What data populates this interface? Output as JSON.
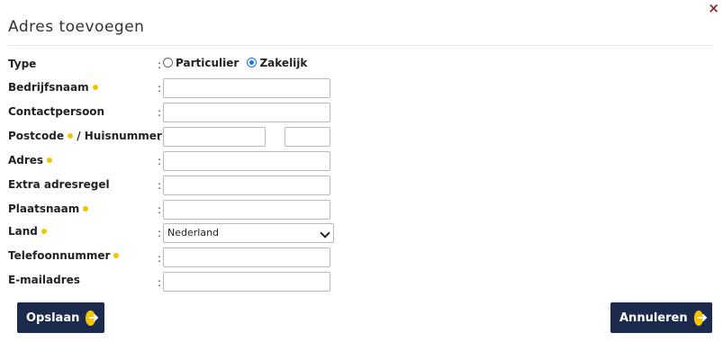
{
  "dialog": {
    "title": "Adres toevoegen",
    "close_icon": "×"
  },
  "form": {
    "colon": ":",
    "type": {
      "label": "Type",
      "options": [
        "Particulier",
        "Zakelijk"
      ],
      "selected": "Zakelijk"
    },
    "bedrijfsnaam": {
      "label": "Bedrijfsnaam",
      "required": true,
      "value": ""
    },
    "contactpersoon": {
      "label": "Contactpersoon",
      "required": false,
      "value": ""
    },
    "postcode": {
      "label": "Postcode",
      "separator": "/ Huisnummer",
      "required": true,
      "value": "",
      "huisnummer_value": ""
    },
    "adres": {
      "label": "Adres",
      "required": true,
      "value": ""
    },
    "extra_adresregel": {
      "label": "Extra adresregel",
      "required": false,
      "value": ""
    },
    "plaatsnaam": {
      "label": "Plaatsnaam",
      "required": true,
      "value": ""
    },
    "land": {
      "label": "Land",
      "required": true,
      "selected": "Nederland"
    },
    "telefoonnummer": {
      "label": "Telefoonnummer",
      "required": true,
      "value": ""
    },
    "emailadres": {
      "label": "E-mailadres",
      "required": false,
      "value": ""
    }
  },
  "buttons": {
    "save_label": "Opslaan",
    "cancel_label": "Annuleren"
  },
  "colors": {
    "button_bg": "#1b2a4d",
    "required_dot": "#f5c400",
    "close_icon": "#8a2a2a"
  },
  "icons": {
    "close": "close-icon",
    "button_arrow": "arrow-right-circle-icon",
    "select_chevron": "chevron-down-icon",
    "required": "required-dot-icon"
  }
}
